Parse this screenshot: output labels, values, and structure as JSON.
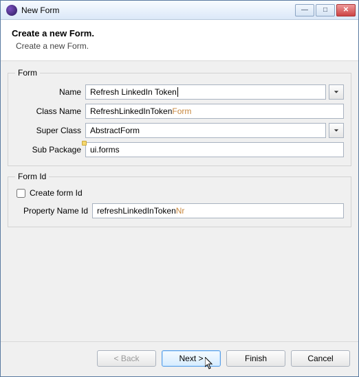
{
  "window": {
    "title": "New Form"
  },
  "header": {
    "title": "Create a new Form.",
    "description": "Create a new Form."
  },
  "groups": {
    "form": {
      "legend": "Form",
      "name_label": "Name",
      "name_value": "Refresh LinkedIn Token",
      "class_label": "Class Name",
      "class_base": "RefreshLinkedInToken",
      "class_suffix": "Form",
      "super_label": "Super Class",
      "super_value": "AbstractForm",
      "subpkg_label": "Sub Package",
      "subpkg_value": "ui.forms"
    },
    "formid": {
      "legend": "Form Id",
      "create_checkbox_label": "Create form Id",
      "create_checkbox_checked": false,
      "prop_label": "Property Name Id",
      "prop_base": "refreshLinkedInToken",
      "prop_suffix": "Nr"
    }
  },
  "buttons": {
    "back": "< Back",
    "next": "Next >",
    "finish": "Finish",
    "cancel": "Cancel"
  }
}
